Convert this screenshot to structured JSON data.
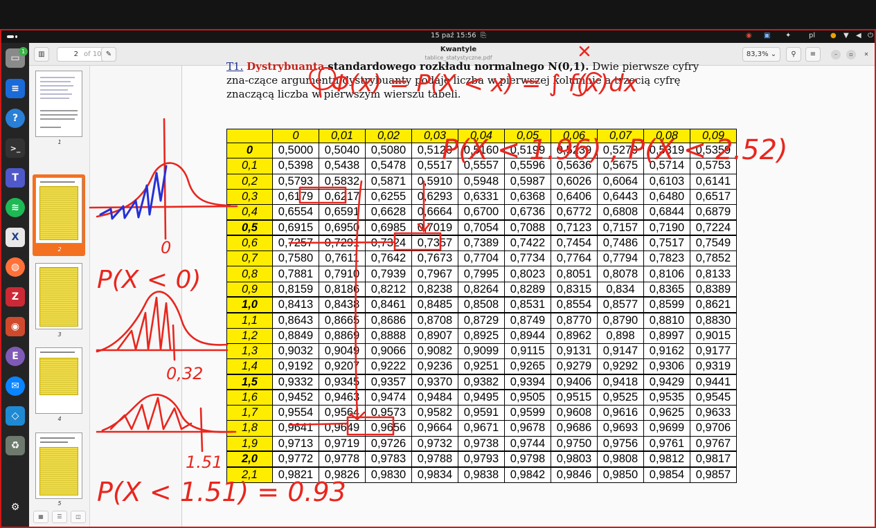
{
  "topbar": {
    "clock": "15 paź 15:56",
    "lang": "pl"
  },
  "dock": {
    "badge": "1",
    "apps": [
      "files-icon",
      "writer-icon",
      "help-icon",
      "terminal-icon",
      "teams-icon",
      "spotify-icon",
      "xmind-icon",
      "firefox-icon",
      "zotero-icon",
      "viewer-icon",
      "emacs-icon",
      "thunderbird-icon",
      "vscode-icon",
      "trash-icon",
      "ubuntu-apps-icon"
    ]
  },
  "viewer": {
    "title": "Kwantyle",
    "subtitle": "tablice_statystyczne.pdf",
    "page_current": "2",
    "page_total": "of 10",
    "zoom": "83,3%",
    "thumbnails": [
      "1",
      "2",
      "3",
      "4",
      "5"
    ]
  },
  "doc": {
    "heading_label": "T1.",
    "heading_red": "Dystrybuanta",
    "heading_bold": "standardowego rozkładu normalnego N(0,1).",
    "heading_rest": "Dwie pierwsze cyfry zna-czące argumentu dystrybuanty podaje liczba w pierwszej kolumnie a trzecią cyfrę znaczącą liczba w pierwszym wierszu tabeli."
  },
  "table": {
    "columns": [
      "0",
      "0,01",
      "0,02",
      "0,03",
      "0,04",
      "0,05",
      "0,06",
      "0,07",
      "0,08",
      "0,09"
    ],
    "rows": [
      {
        "z": "0",
        "thick": false,
        "bold": true,
        "v": [
          "0,5000",
          "0,5040",
          "0,5080",
          "0,5120",
          "0,5160",
          "0,5199",
          "0,5239",
          "0,5279",
          "0,5319",
          "0,5359"
        ]
      },
      {
        "z": "0,1",
        "thick": false,
        "bold": false,
        "v": [
          "0,5398",
          "0,5438",
          "0,5478",
          "0,5517",
          "0,5557",
          "0,5596",
          "0,5636",
          "0,5675",
          "0,5714",
          "0,5753"
        ]
      },
      {
        "z": "0,2",
        "thick": false,
        "bold": false,
        "v": [
          "0,5793",
          "0,5832",
          "0,5871",
          "0,5910",
          "0,5948",
          "0,5987",
          "0,6026",
          "0,6064",
          "0,6103",
          "0,6141"
        ]
      },
      {
        "z": "0,3",
        "thick": false,
        "bold": false,
        "v": [
          "0,6179",
          "0,6217",
          "0,6255",
          "0,6293",
          "0,6331",
          "0,6368",
          "0,6406",
          "0,6443",
          "0,6480",
          "0,6517"
        ]
      },
      {
        "z": "0,4",
        "thick": false,
        "bold": false,
        "v": [
          "0,6554",
          "0,6591",
          "0,6628",
          "0,6664",
          "0,6700",
          "0,6736",
          "0,6772",
          "0,6808",
          "0,6844",
          "0,6879"
        ]
      },
      {
        "z": "0,5",
        "thick": true,
        "bold": true,
        "v": [
          "0,6915",
          "0,6950",
          "0,6985",
          "0,7019",
          "0,7054",
          "0,7088",
          "0,7123",
          "0,7157",
          "0,7190",
          "0,7224"
        ]
      },
      {
        "z": "0,6",
        "thick": false,
        "bold": false,
        "v": [
          "0,7257",
          "0,7291",
          "0,7324",
          "0,7357",
          "0,7389",
          "0,7422",
          "0,7454",
          "0,7486",
          "0,7517",
          "0,7549"
        ]
      },
      {
        "z": "0,7",
        "thick": false,
        "bold": false,
        "v": [
          "0,7580",
          "0,7611",
          "0,7642",
          "0,7673",
          "0,7704",
          "0,7734",
          "0,7764",
          "0,7794",
          "0,7823",
          "0,7852"
        ]
      },
      {
        "z": "0,8",
        "thick": false,
        "bold": false,
        "v": [
          "0,7881",
          "0,7910",
          "0,7939",
          "0,7967",
          "0,7995",
          "0,8023",
          "0,8051",
          "0,8078",
          "0,8106",
          "0,8133"
        ]
      },
      {
        "z": "0,9",
        "thick": false,
        "bold": false,
        "v": [
          "0,8159",
          "0,8186",
          "0,8212",
          "0,8238",
          "0,8264",
          "0,8289",
          "0,8315",
          "0,834",
          "0,8365",
          "0,8389"
        ]
      },
      {
        "z": "1,0",
        "thick": true,
        "bold": true,
        "v": [
          "0,8413",
          "0,8438",
          "0,8461",
          "0,8485",
          "0,8508",
          "0,8531",
          "0,8554",
          "0,8577",
          "0,8599",
          "0,8621"
        ]
      },
      {
        "z": "1,1",
        "thick": false,
        "bold": false,
        "v": [
          "0,8643",
          "0,8665",
          "0,8686",
          "0,8708",
          "0,8729",
          "0,8749",
          "0,8770",
          "0,8790",
          "0,8810",
          "0,8830"
        ]
      },
      {
        "z": "1,2",
        "thick": false,
        "bold": false,
        "v": [
          "0,8849",
          "0,8869",
          "0,8888",
          "0,8907",
          "0,8925",
          "0,8944",
          "0,8962",
          "0,898",
          "0,8997",
          "0,9015"
        ]
      },
      {
        "z": "1,3",
        "thick": false,
        "bold": false,
        "v": [
          "0,9032",
          "0,9049",
          "0,9066",
          "0,9082",
          "0,9099",
          "0,9115",
          "0,9131",
          "0,9147",
          "0,9162",
          "0,9177"
        ]
      },
      {
        "z": "1,4",
        "thick": false,
        "bold": false,
        "v": [
          "0,9192",
          "0,9207",
          "0,9222",
          "0,9236",
          "0,9251",
          "0,9265",
          "0,9279",
          "0,9292",
          "0,9306",
          "0,9319"
        ]
      },
      {
        "z": "1,5",
        "thick": true,
        "bold": true,
        "v": [
          "0,9332",
          "0,9345",
          "0,9357",
          "0,9370",
          "0,9382",
          "0,9394",
          "0,9406",
          "0,9418",
          "0,9429",
          "0,9441"
        ]
      },
      {
        "z": "1,6",
        "thick": false,
        "bold": false,
        "v": [
          "0,9452",
          "0,9463",
          "0,9474",
          "0,9484",
          "0,9495",
          "0,9505",
          "0,9515",
          "0,9525",
          "0,9535",
          "0,9545"
        ]
      },
      {
        "z": "1,7",
        "thick": false,
        "bold": false,
        "v": [
          "0,9554",
          "0,9564",
          "0,9573",
          "0,9582",
          "0,9591",
          "0,9599",
          "0,9608",
          "0,9616",
          "0,9625",
          "0,9633"
        ]
      },
      {
        "z": "1,8",
        "thick": false,
        "bold": false,
        "v": [
          "0,9641",
          "0,9649",
          "0,9656",
          "0,9664",
          "0,9671",
          "0,9678",
          "0,9686",
          "0,9693",
          "0,9699",
          "0,9706"
        ]
      },
      {
        "z": "1,9",
        "thick": false,
        "bold": false,
        "v": [
          "0,9713",
          "0,9719",
          "0,9726",
          "0,9732",
          "0,9738",
          "0,9744",
          "0,9750",
          "0,9756",
          "0,9761",
          "0,9767"
        ]
      },
      {
        "z": "2,0",
        "thick": true,
        "bold": true,
        "v": [
          "0,9772",
          "0,9778",
          "0,9783",
          "0,9788",
          "0,9793",
          "0,9798",
          "0,9803",
          "0,9808",
          "0,9812",
          "0,9817"
        ]
      },
      {
        "z": "2,1",
        "thick": false,
        "bold": false,
        "v": [
          "0,9821",
          "0,9826",
          "0,9830",
          "0,9834",
          "0,9838",
          "0,9842",
          "0,9846",
          "0,9850",
          "0,9854",
          "0,9857"
        ]
      }
    ]
  },
  "annotations": {
    "formula": "Φ(x) = P(X < x) = ∫ f(x)dx",
    "upper_limit": "x",
    "lower_limit": "-∞",
    "query": "P(X < 1.96) , P(X < 2.52)",
    "note_zero_label": "0",
    "note_zero": "P(X < 0)",
    "note_032": "0,32",
    "note_151_label": "1.51",
    "note_151": "P(X < 1.51) = 0.93",
    "ink_color": "#e8261e",
    "blue_ink_color": "#2430d8"
  },
  "colors": {
    "header_yellow": "#ffed00",
    "accent_orange": "#f37021",
    "heading_red": "#c4241c"
  }
}
